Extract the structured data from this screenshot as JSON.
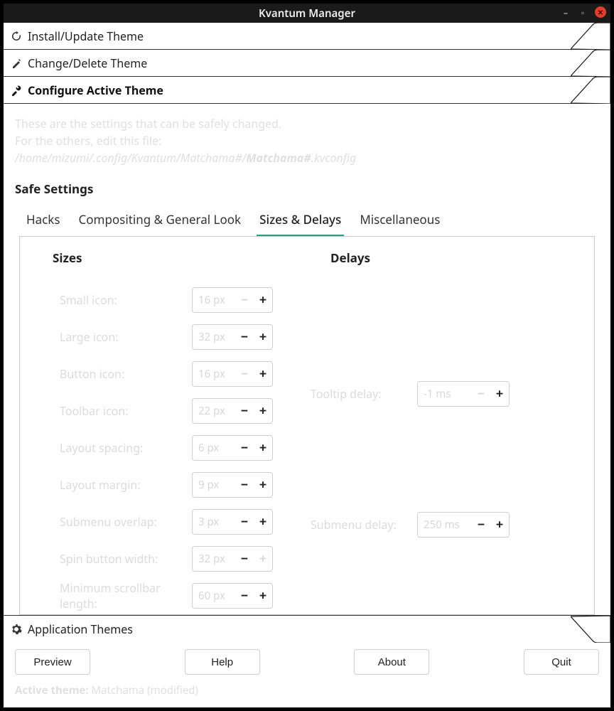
{
  "window": {
    "title": "Kvantum Manager"
  },
  "sections": {
    "install": "Install/Update Theme",
    "change": "Change/Delete Theme",
    "configure": "Configure Active Theme",
    "appthemes": "Application Themes"
  },
  "intro": {
    "line1": "These are the settings that can be safely changed.",
    "line2": "For the others, edit this file:",
    "path_prefix": "/home/mizumi/.config/Kvantum/Matchama#/",
    "path_strong": "Matchama#",
    "path_suffix": ".kvconfig"
  },
  "safe_heading": "Safe Settings",
  "tabs": {
    "hacks": "Hacks",
    "comp": "Compositing & General Look",
    "sizes": "Sizes & Delays",
    "misc": "Miscellaneous"
  },
  "headings": {
    "sizes": "Sizes",
    "delays": "Delays"
  },
  "sizes": {
    "small_icon": {
      "label": "Small icon:",
      "value": "16 px"
    },
    "large_icon": {
      "label": "Large icon:",
      "value": "32 px"
    },
    "button_icon": {
      "label": "Button icon:",
      "value": "16 px"
    },
    "toolbar_icon": {
      "label": "Toolbar icon:",
      "value": "22 px"
    },
    "layout_spacing": {
      "label": "Layout spacing:",
      "value": "6 px"
    },
    "layout_margin": {
      "label": "Layout margin:",
      "value": "9 px"
    },
    "submenu_overlap": {
      "label": "Submenu overlap:",
      "value": "3 px"
    },
    "spin_width": {
      "label": "Spin button width:",
      "value": "32 px"
    },
    "min_scrollbar": {
      "label": "Minimum scrollbar length:",
      "value": "60 px"
    }
  },
  "delays": {
    "tooltip": {
      "label": "Tooltip delay:",
      "value": "-1 ms"
    },
    "submenu": {
      "label": "Submenu delay:",
      "value": "250 ms"
    }
  },
  "buttons": {
    "preview": "Preview",
    "help": "Help",
    "about": "About",
    "quit": "Quit"
  },
  "status": {
    "label": "Active theme:",
    "value": " Matchama (modified)"
  }
}
